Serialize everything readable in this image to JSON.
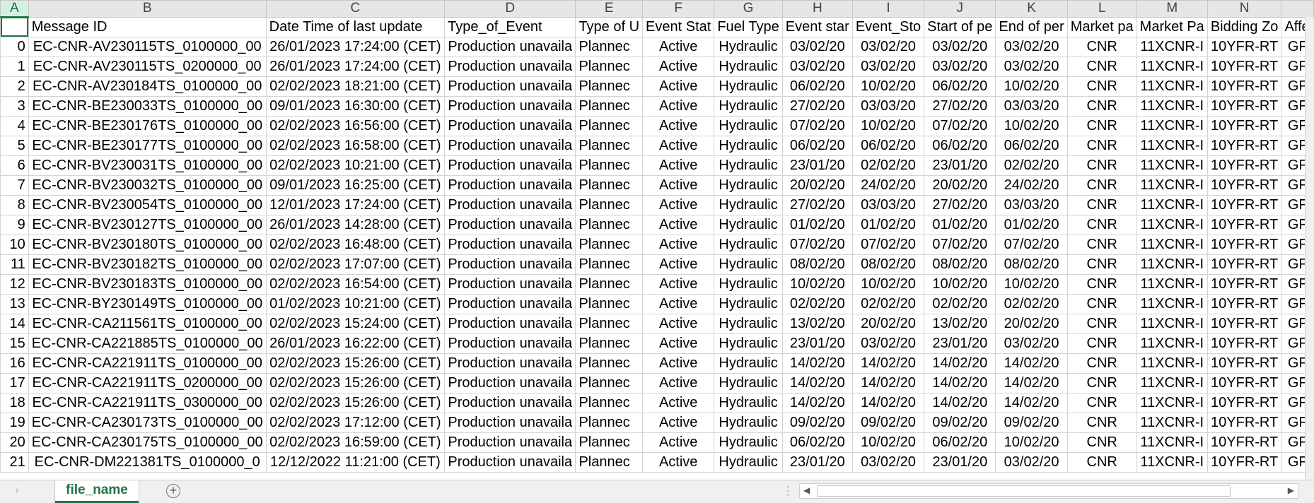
{
  "columns": [
    {
      "letter": "A",
      "header": ""
    },
    {
      "letter": "B",
      "header": "Message ID"
    },
    {
      "letter": "C",
      "header": "Date Time of last update"
    },
    {
      "letter": "D",
      "header": "Type_of_Event"
    },
    {
      "letter": "E",
      "header": "Type of U"
    },
    {
      "letter": "F",
      "header": "Event Stat"
    },
    {
      "letter": "G",
      "header": "Fuel Type"
    },
    {
      "letter": "H",
      "header": "Event star"
    },
    {
      "letter": "I",
      "header": "Event_Sto"
    },
    {
      "letter": "J",
      "header": "Start of pe"
    },
    {
      "letter": "K",
      "header": "End of per"
    },
    {
      "letter": "L",
      "header": "Market pa"
    },
    {
      "letter": "M",
      "header": "Market Pa"
    },
    {
      "letter": "N",
      "header": "Bidding Zo"
    },
    {
      "letter": "",
      "header": "Affe"
    }
  ],
  "rows": [
    [
      "0",
      "EC-CNR-AV230115TS_0100000_00",
      "26/01/2023 17:24:00 (CET)",
      "Production unavaila",
      "Plannec",
      "Active",
      "Hydraulic",
      "03/02/20",
      "03/02/20",
      "03/02/20",
      "03/02/20",
      "CNR",
      "11XCNR-I",
      "10YFR-RT",
      "GF"
    ],
    [
      "1",
      "EC-CNR-AV230115TS_0200000_00",
      "26/01/2023 17:24:00 (CET)",
      "Production unavaila",
      "Plannec",
      "Active",
      "Hydraulic",
      "03/02/20",
      "03/02/20",
      "03/02/20",
      "03/02/20",
      "CNR",
      "11XCNR-I",
      "10YFR-RT",
      "GF"
    ],
    [
      "2",
      "EC-CNR-AV230184TS_0100000_00",
      "02/02/2023 18:21:00 (CET)",
      "Production unavaila",
      "Plannec",
      "Active",
      "Hydraulic",
      "06/02/20",
      "10/02/20",
      "06/02/20",
      "10/02/20",
      "CNR",
      "11XCNR-I",
      "10YFR-RT",
      "GF"
    ],
    [
      "3",
      "EC-CNR-BE230033TS_0100000_00",
      "09/01/2023 16:30:00 (CET)",
      "Production unavaila",
      "Plannec",
      "Active",
      "Hydraulic",
      "27/02/20",
      "03/03/20",
      "27/02/20",
      "03/03/20",
      "CNR",
      "11XCNR-I",
      "10YFR-RT",
      "GF"
    ],
    [
      "4",
      "EC-CNR-BE230176TS_0100000_00",
      "02/02/2023 16:56:00 (CET)",
      "Production unavaila",
      "Plannec",
      "Active",
      "Hydraulic",
      "07/02/20",
      "10/02/20",
      "07/02/20",
      "10/02/20",
      "CNR",
      "11XCNR-I",
      "10YFR-RT",
      "GF"
    ],
    [
      "5",
      "EC-CNR-BE230177TS_0100000_00",
      "02/02/2023 16:58:00 (CET)",
      "Production unavaila",
      "Plannec",
      "Active",
      "Hydraulic",
      "06/02/20",
      "06/02/20",
      "06/02/20",
      "06/02/20",
      "CNR",
      "11XCNR-I",
      "10YFR-RT",
      "GF"
    ],
    [
      "6",
      "EC-CNR-BV230031TS_0100000_00",
      "02/02/2023 10:21:00 (CET)",
      "Production unavaila",
      "Plannec",
      "Active",
      "Hydraulic",
      "23/01/20",
      "02/02/20",
      "23/01/20",
      "02/02/20",
      "CNR",
      "11XCNR-I",
      "10YFR-RT",
      "GF"
    ],
    [
      "7",
      "EC-CNR-BV230032TS_0100000_00",
      "09/01/2023 16:25:00 (CET)",
      "Production unavaila",
      "Plannec",
      "Active",
      "Hydraulic",
      "20/02/20",
      "24/02/20",
      "20/02/20",
      "24/02/20",
      "CNR",
      "11XCNR-I",
      "10YFR-RT",
      "GF"
    ],
    [
      "8",
      "EC-CNR-BV230054TS_0100000_00",
      "12/01/2023 17:24:00 (CET)",
      "Production unavaila",
      "Plannec",
      "Active",
      "Hydraulic",
      "27/02/20",
      "03/03/20",
      "27/02/20",
      "03/03/20",
      "CNR",
      "11XCNR-I",
      "10YFR-RT",
      "GF"
    ],
    [
      "9",
      "EC-CNR-BV230127TS_0100000_00",
      "26/01/2023 14:28:00 (CET)",
      "Production unavaila",
      "Plannec",
      "Active",
      "Hydraulic",
      "01/02/20",
      "01/02/20",
      "01/02/20",
      "01/02/20",
      "CNR",
      "11XCNR-I",
      "10YFR-RT",
      "GF"
    ],
    [
      "10",
      "EC-CNR-BV230180TS_0100000_00",
      "02/02/2023 16:48:00 (CET)",
      "Production unavaila",
      "Plannec",
      "Active",
      "Hydraulic",
      "07/02/20",
      "07/02/20",
      "07/02/20",
      "07/02/20",
      "CNR",
      "11XCNR-I",
      "10YFR-RT",
      "GF"
    ],
    [
      "11",
      "EC-CNR-BV230182TS_0100000_00",
      "02/02/2023 17:07:00 (CET)",
      "Production unavaila",
      "Plannec",
      "Active",
      "Hydraulic",
      "08/02/20",
      "08/02/20",
      "08/02/20",
      "08/02/20",
      "CNR",
      "11XCNR-I",
      "10YFR-RT",
      "GF"
    ],
    [
      "12",
      "EC-CNR-BV230183TS_0100000_00",
      "02/02/2023 16:54:00 (CET)",
      "Production unavaila",
      "Plannec",
      "Active",
      "Hydraulic",
      "10/02/20",
      "10/02/20",
      "10/02/20",
      "10/02/20",
      "CNR",
      "11XCNR-I",
      "10YFR-RT",
      "GF"
    ],
    [
      "13",
      "EC-CNR-BY230149TS_0100000_00",
      "01/02/2023 10:21:00 (CET)",
      "Production unavaila",
      "Plannec",
      "Active",
      "Hydraulic",
      "02/02/20",
      "02/02/20",
      "02/02/20",
      "02/02/20",
      "CNR",
      "11XCNR-I",
      "10YFR-RT",
      "GF"
    ],
    [
      "14",
      "EC-CNR-CA211561TS_0100000_00",
      "02/02/2023 15:24:00 (CET)",
      "Production unavaila",
      "Plannec",
      "Active",
      "Hydraulic",
      "13/02/20",
      "20/02/20",
      "13/02/20",
      "20/02/20",
      "CNR",
      "11XCNR-I",
      "10YFR-RT",
      "GF"
    ],
    [
      "15",
      "EC-CNR-CA221885TS_0100000_00",
      "26/01/2023 16:22:00 (CET)",
      "Production unavaila",
      "Plannec",
      "Active",
      "Hydraulic",
      "23/01/20",
      "03/02/20",
      "23/01/20",
      "03/02/20",
      "CNR",
      "11XCNR-I",
      "10YFR-RT",
      "GF"
    ],
    [
      "16",
      "EC-CNR-CA221911TS_0100000_00",
      "02/02/2023 15:26:00 (CET)",
      "Production unavaila",
      "Plannec",
      "Active",
      "Hydraulic",
      "14/02/20",
      "14/02/20",
      "14/02/20",
      "14/02/20",
      "CNR",
      "11XCNR-I",
      "10YFR-RT",
      "GF"
    ],
    [
      "17",
      "EC-CNR-CA221911TS_0200000_00",
      "02/02/2023 15:26:00 (CET)",
      "Production unavaila",
      "Plannec",
      "Active",
      "Hydraulic",
      "14/02/20",
      "14/02/20",
      "14/02/20",
      "14/02/20",
      "CNR",
      "11XCNR-I",
      "10YFR-RT",
      "GF"
    ],
    [
      "18",
      "EC-CNR-CA221911TS_0300000_00",
      "02/02/2023 15:26:00 (CET)",
      "Production unavaila",
      "Plannec",
      "Active",
      "Hydraulic",
      "14/02/20",
      "14/02/20",
      "14/02/20",
      "14/02/20",
      "CNR",
      "11XCNR-I",
      "10YFR-RT",
      "GF"
    ],
    [
      "19",
      "EC-CNR-CA230173TS_0100000_00",
      "02/02/2023 17:12:00 (CET)",
      "Production unavaila",
      "Plannec",
      "Active",
      "Hydraulic",
      "09/02/20",
      "09/02/20",
      "09/02/20",
      "09/02/20",
      "CNR",
      "11XCNR-I",
      "10YFR-RT",
      "GF"
    ],
    [
      "20",
      "EC-CNR-CA230175TS_0100000_00",
      "02/02/2023 16:59:00 (CET)",
      "Production unavaila",
      "Plannec",
      "Active",
      "Hydraulic",
      "06/02/20",
      "10/02/20",
      "06/02/20",
      "10/02/20",
      "CNR",
      "11XCNR-I",
      "10YFR-RT",
      "GF"
    ],
    [
      "21",
      "EC-CNR-DM221381TS_0100000_0",
      "12/12/2022 11:21:00 (CET)",
      "Production unavaila",
      "Plannec",
      "Active",
      "Hydraulic",
      "23/01/20",
      "03/02/20",
      "23/01/20",
      "03/02/20",
      "CNR",
      "11XCNR-I",
      "10YFR-RT",
      "GF"
    ]
  ],
  "sheet_tab": "file_name",
  "add_sheet_symbol": "+",
  "colors": {
    "accent": "#217346",
    "header_bg": "#e6e6e6",
    "selected_col_bg": "#d3f0e0"
  }
}
